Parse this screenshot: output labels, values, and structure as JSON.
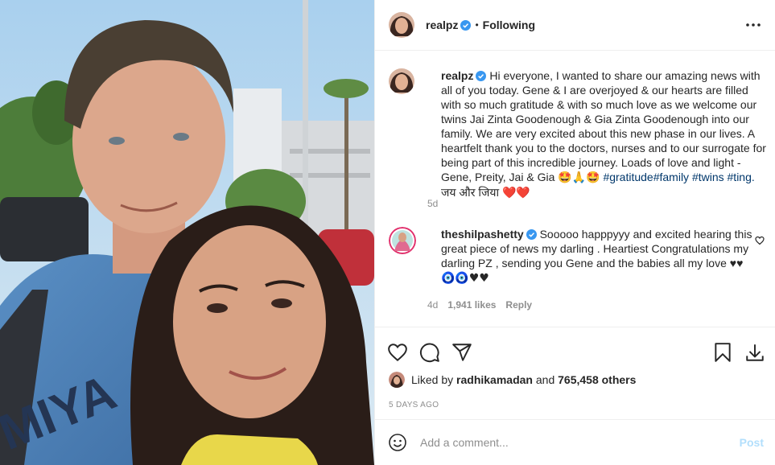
{
  "header": {
    "username": "realpz",
    "separator": "•",
    "follow_status": "Following"
  },
  "caption": {
    "username": "realpz",
    "text": "Hi everyone, I wanted to share our amazing news with all of you today. Gene & I are overjoyed & our hearts are filled with so much gratitude & with so much love as we welcome our twins Jai Zinta Goodenough & Gia Zinta Goodenough into our family. We are very excited about this new phase in our lives. A heartfelt thank you to the doctors, nurses and to our surrogate for being part of this incredible journey. Loads of love and light - Gene, Preity, Jai & Gia",
    "emojis": "🤩🙏🤩",
    "hashtags": "#gratitude#family #twins #ting.",
    "hindi": "जय और जिया",
    "hearts": "❤️❤️",
    "time": "5d"
  },
  "comment": {
    "username": "theshilpashetty",
    "text": "Sooooo happpyyy and excited hearing this great piece of news my darling . Heartiest Congratulations my darling PZ , sending you Gene and the babies all my love ♥♥",
    "emojis": "🧿🧿♥♥",
    "time": "4d",
    "likes": "1,941 likes",
    "reply": "Reply"
  },
  "likes": {
    "prefix": "Liked by",
    "liker": "radhikamadan",
    "conj": "and",
    "others": "765,458 others"
  },
  "posted_ago": "5 DAYS AGO",
  "add_comment": {
    "placeholder": "Add a comment...",
    "post_label": "Post"
  },
  "icons": {
    "more": "more-options-icon",
    "like": "heart-icon",
    "comment": "comment-icon",
    "share": "share-icon",
    "save": "bookmark-icon",
    "download": "download-icon",
    "emoji": "emoji-icon",
    "verified": "verified-badge-icon"
  },
  "colors": {
    "verified": "#3897f0",
    "link": "#00376b",
    "muted": "#8e8e8e",
    "post_disabled": "#b2dffc"
  }
}
